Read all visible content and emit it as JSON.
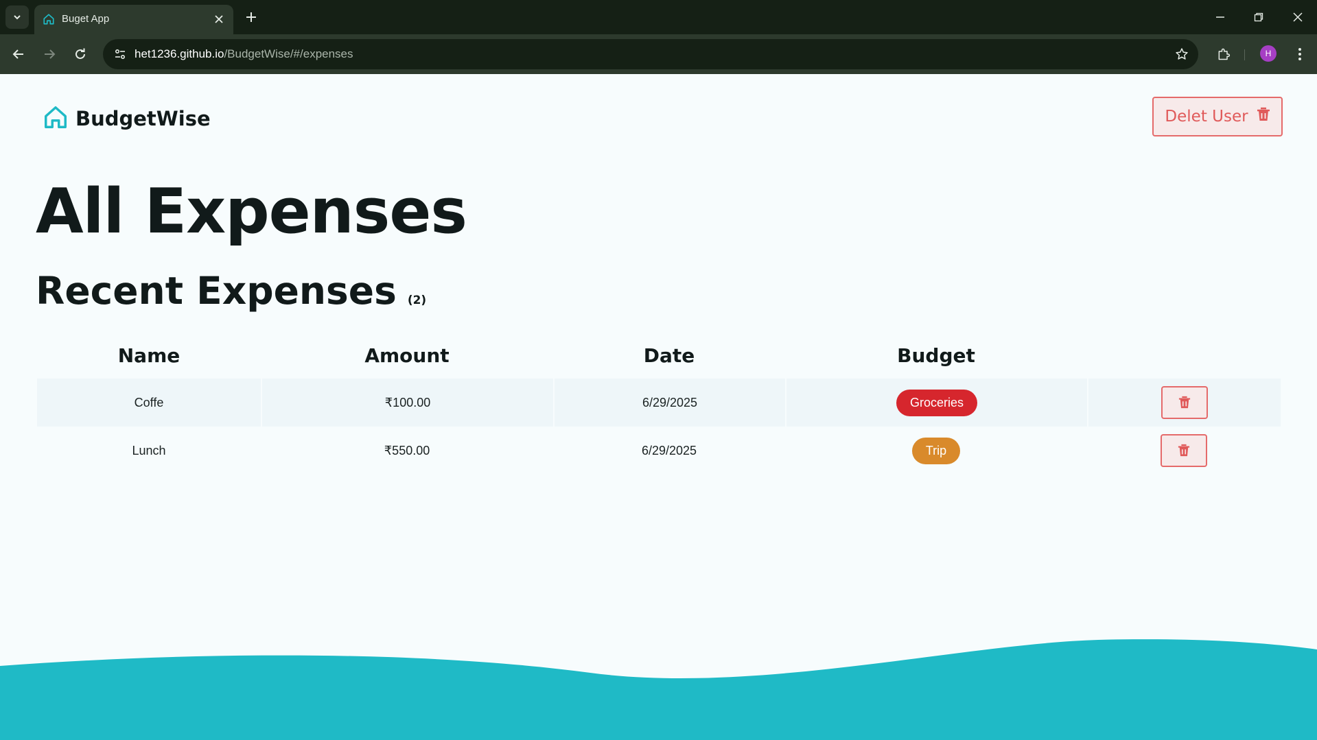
{
  "browser": {
    "tab_title": "Buget App",
    "url_host": "het1236.github.io",
    "url_path": "/BudgetWise/#/expenses",
    "profile_initial": "H"
  },
  "header": {
    "brand": "BudgetWise",
    "delete_user_label": "Delet User"
  },
  "main": {
    "title": "All Expenses",
    "subtitle": "Recent Expenses",
    "count": "(2)"
  },
  "table": {
    "columns": [
      "Name",
      "Amount",
      "Date",
      "Budget",
      ""
    ],
    "rows": [
      {
        "name": "Coffe",
        "amount": "₹100.00",
        "date": "6/29/2025",
        "budget": "Groceries",
        "budget_color": "#d6262d"
      },
      {
        "name": "Lunch",
        "amount": "₹550.00",
        "date": "6/29/2025",
        "budget": "Trip",
        "budget_color": "#d98a2b"
      }
    ]
  },
  "colors": {
    "accent": "#1fbac6",
    "danger": "#e05a5a"
  }
}
